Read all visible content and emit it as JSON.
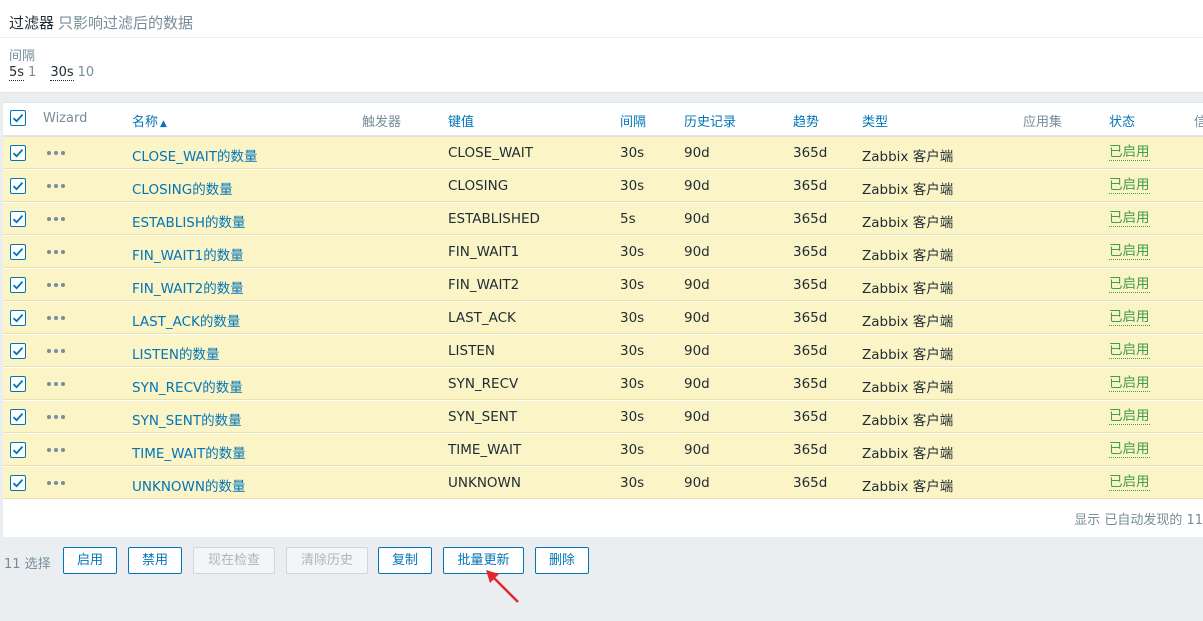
{
  "filter": {
    "title": "过滤器",
    "subtitle": "只影响过滤后的数据",
    "interval_label": "间隔",
    "intervals": [
      {
        "value": "5s",
        "count": "1"
      },
      {
        "value": "30s",
        "count": "10"
      }
    ]
  },
  "table": {
    "headers": {
      "wizard": "Wizard",
      "name": "名称",
      "sort_arrow": "▲",
      "triggers": "触发器",
      "key": "键值",
      "interval": "间隔",
      "history": "历史记录",
      "trends": "趋势",
      "type": "类型",
      "applications": "应用集",
      "status": "状态",
      "info": "信"
    },
    "rows": [
      {
        "name": "CLOSE_WAIT的数量",
        "key": "CLOSE_WAIT",
        "interval": "30s",
        "history": "90d",
        "trends": "365d",
        "type": "Zabbix 客户端",
        "status": "已启用"
      },
      {
        "name": "CLOSING的数量",
        "key": "CLOSING",
        "interval": "30s",
        "history": "90d",
        "trends": "365d",
        "type": "Zabbix 客户端",
        "status": "已启用"
      },
      {
        "name": "ESTABLISH的数量",
        "key": "ESTABLISHED",
        "interval": "5s",
        "history": "90d",
        "trends": "365d",
        "type": "Zabbix 客户端",
        "status": "已启用"
      },
      {
        "name": "FIN_WAIT1的数量",
        "key": "FIN_WAIT1",
        "interval": "30s",
        "history": "90d",
        "trends": "365d",
        "type": "Zabbix 客户端",
        "status": "已启用"
      },
      {
        "name": "FIN_WAIT2的数量",
        "key": "FIN_WAIT2",
        "interval": "30s",
        "history": "90d",
        "trends": "365d",
        "type": "Zabbix 客户端",
        "status": "已启用"
      },
      {
        "name": "LAST_ACK的数量",
        "key": "LAST_ACK",
        "interval": "30s",
        "history": "90d",
        "trends": "365d",
        "type": "Zabbix 客户端",
        "status": "已启用"
      },
      {
        "name": "LISTEN的数量",
        "key": "LISTEN",
        "interval": "30s",
        "history": "90d",
        "trends": "365d",
        "type": "Zabbix 客户端",
        "status": "已启用"
      },
      {
        "name": "SYN_RECV的数量",
        "key": "SYN_RECV",
        "interval": "30s",
        "history": "90d",
        "trends": "365d",
        "type": "Zabbix 客户端",
        "status": "已启用"
      },
      {
        "name": "SYN_SENT的数量",
        "key": "SYN_SENT",
        "interval": "30s",
        "history": "90d",
        "trends": "365d",
        "type": "Zabbix 客户端",
        "status": "已启用"
      },
      {
        "name": "TIME_WAIT的数量",
        "key": "TIME_WAIT",
        "interval": "30s",
        "history": "90d",
        "trends": "365d",
        "type": "Zabbix 客户端",
        "status": "已启用"
      },
      {
        "name": "UNKNOWN的数量",
        "key": "UNKNOWN",
        "interval": "30s",
        "history": "90d",
        "trends": "365d",
        "type": "Zabbix 客户端",
        "status": "已启用"
      }
    ],
    "footer": "显示 已自动发现的 11"
  },
  "actions": {
    "selected": "11 选择",
    "enable": "启用",
    "disable": "禁用",
    "check_now": "现在检查",
    "clear_history": "清除历史",
    "copy": "复制",
    "mass_update": "批量更新",
    "delete": "删除"
  },
  "colors": {
    "accent": "#0275b8",
    "row_highlight": "#fbf4c6",
    "status_enabled": "#429e47",
    "annotation_arrow": "#e0282e"
  }
}
